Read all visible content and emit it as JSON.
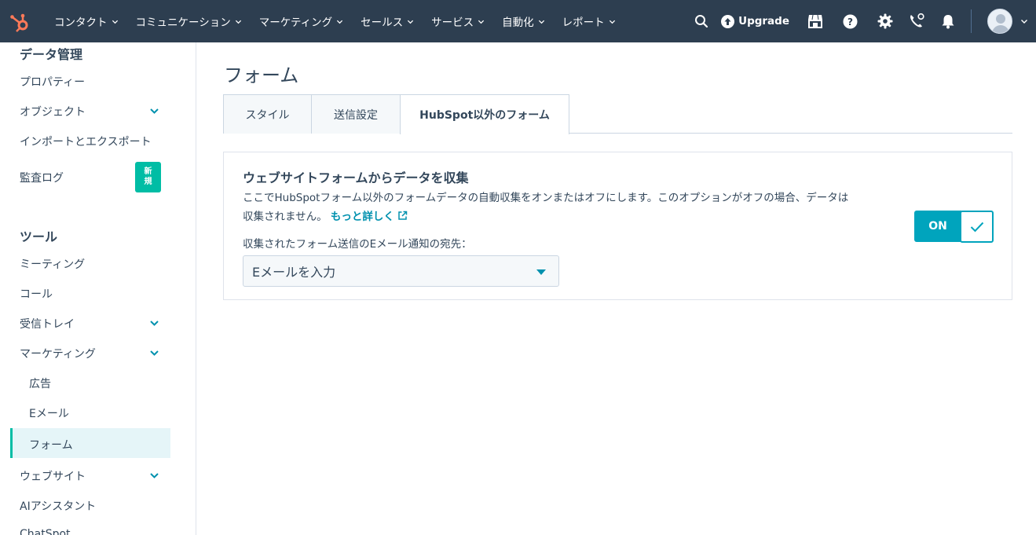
{
  "nav": {
    "menu": [
      {
        "label": "コンタクト"
      },
      {
        "label": "コミュニケーション"
      },
      {
        "label": "マーケティング"
      },
      {
        "label": "セールス"
      },
      {
        "label": "サービス"
      },
      {
        "label": "自動化"
      },
      {
        "label": "レポート"
      }
    ],
    "upgrade_label": "Upgrade",
    "icons": [
      "search-icon",
      "upgrade-icon",
      "marketplace-icon",
      "help-icon",
      "settings-icon",
      "calling-icon",
      "notifications-icon",
      "avatar"
    ],
    "colors": {
      "bar": "#2d3e50",
      "logo": "#ff7a59"
    }
  },
  "sidebar": {
    "section_data": "データ管理",
    "items_data": [
      {
        "label": "プロパティー"
      },
      {
        "label": "オブジェクト"
      },
      {
        "label": "インポートとエクスポート"
      },
      {
        "label": "監査ログ"
      }
    ],
    "badge": {
      "line1": "新",
      "line2": "規"
    },
    "section_tools": "ツール",
    "items_tools": [
      {
        "label": "ミーティング"
      },
      {
        "label": "コール"
      },
      {
        "label": "受信トレイ"
      },
      {
        "label": "マーケティング"
      }
    ],
    "marketing_sub": [
      {
        "label": "広告"
      },
      {
        "label": "Eメール"
      },
      {
        "label": "フォーム"
      }
    ],
    "items_after": [
      {
        "label": "ウェブサイト"
      },
      {
        "label": "AIアシスタント"
      },
      {
        "label": "ChatSpot"
      }
    ],
    "active_item": "フォーム",
    "accent_color": "#00bda5"
  },
  "main": {
    "title": "フォーム",
    "tabs": [
      {
        "label": "スタイル"
      },
      {
        "label": "送信設定"
      },
      {
        "label": "HubSpot以外のフォーム"
      }
    ],
    "active_tab": "HubSpot以外のフォーム",
    "card": {
      "title": "ウェブサイトフォームからデータを収集",
      "desc_line1": "ここでHubSpotフォーム以外のフォームデータの自動収集をオンまたはオフにします。このオプションがオフの場合、データは",
      "desc_line2": "収集されません。",
      "more_link": "もっと詳しく",
      "email_label": "収集されたフォーム送信のEメール通知の宛先：",
      "email_placeholder": "Eメールを入力",
      "toggle_label": "ON",
      "toggle_state": "on",
      "toggle_color": "#00a4bd"
    }
  }
}
